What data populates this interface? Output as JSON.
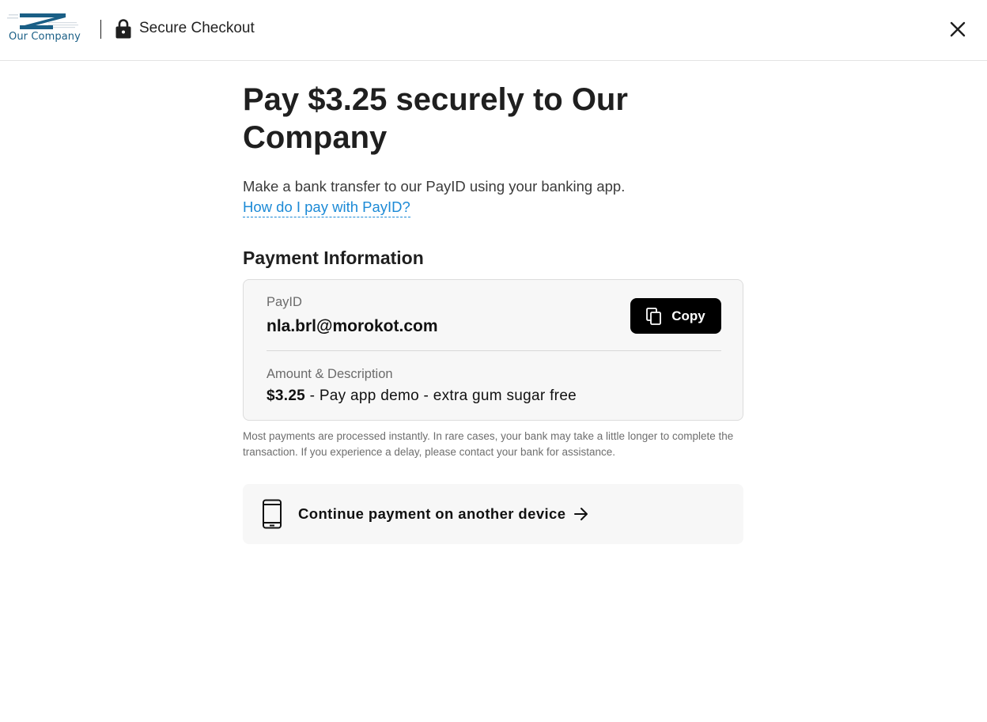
{
  "header": {
    "company_name": "Our Company",
    "title": "Secure Checkout",
    "icons": {
      "logo": "company-logo",
      "lock": "lock-icon",
      "close": "close-icon"
    }
  },
  "main": {
    "heading": "Pay $3.25 securely to Our Company",
    "subtext": "Make a bank transfer to our PayID using your banking app.",
    "help_link": "How do I pay with PayID?",
    "section_title": "Payment Information",
    "payid": {
      "label": "PayID",
      "value": "nla.brl@morokot.com",
      "copy_label": "Copy",
      "copy_icon": "copy-icon"
    },
    "amount": {
      "label": "Amount & Description",
      "value": "$3.25",
      "description": " - Pay app demo - extra gum sugar free"
    },
    "notice": "Most payments are processed instantly. In rare cases, your bank may take a little longer to complete the transaction. If you experience a delay, please contact your bank for assistance.",
    "continue": {
      "label": "Continue payment on another device",
      "icon": "phone-icon",
      "arrow": "arrow-right-icon"
    }
  },
  "colors": {
    "link": "#1c8ad6",
    "brand": "#1a5f86",
    "button_bg": "#000000",
    "card_bg": "#f7f7f7"
  }
}
